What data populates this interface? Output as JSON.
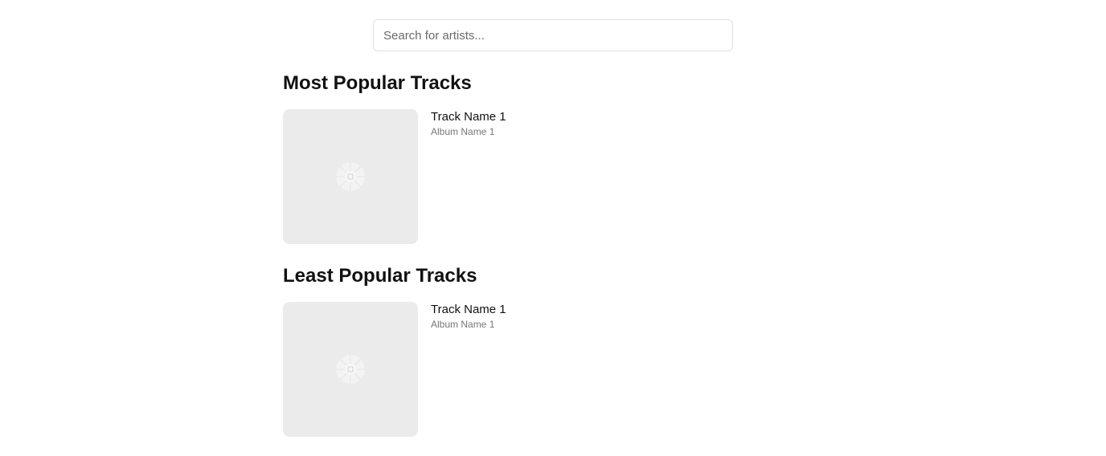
{
  "search": {
    "placeholder": "Search for artists..."
  },
  "sections": [
    {
      "title": "Most Popular Tracks",
      "tracks": [
        {
          "name": "Track Name 1",
          "album": "Album Name 1",
          "cover_icon": "broken-image-icon"
        }
      ]
    },
    {
      "title": "Least Popular Tracks",
      "tracks": [
        {
          "name": "Track Name 1",
          "album": "Album Name 1",
          "cover_icon": "broken-image-icon"
        }
      ]
    }
  ],
  "colors": {
    "cover_placeholder": "#ebebeb",
    "album_text": "#777777",
    "search_border": "#e0e0e0"
  }
}
